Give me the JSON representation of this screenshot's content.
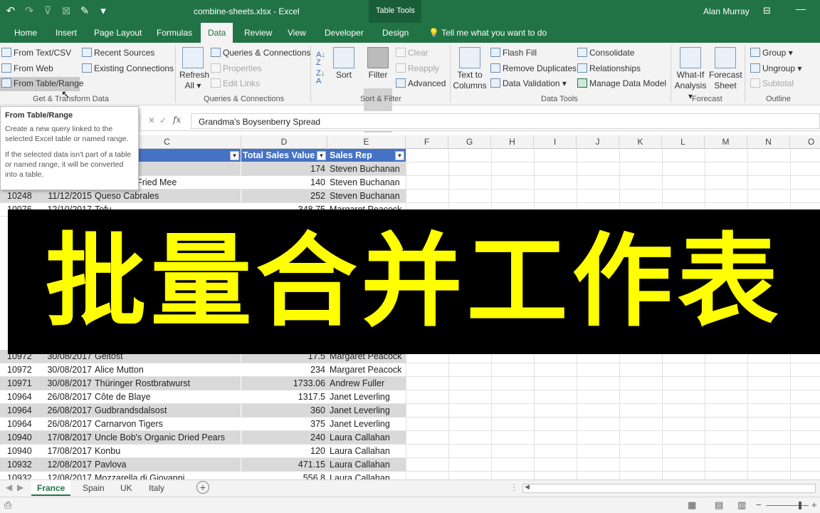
{
  "window": {
    "title": "combine-sheets.xlsx  -  Excel",
    "context_tab": "Table Tools",
    "user": "Alan Murray"
  },
  "tabs": [
    "Home",
    "Insert",
    "Page Layout",
    "Formulas",
    "Data",
    "Review",
    "View",
    "Developer",
    "Design"
  ],
  "tell_me": "Tell me what you want to do",
  "ribbon": {
    "get_transform": {
      "label": "Get & Transform Data",
      "from_text": "From Text/CSV",
      "from_web": "From Web",
      "from_table": "From Table/Range",
      "recent": "Recent Sources",
      "existing": "Existing Connections"
    },
    "queries": {
      "label": "Queries & Connections",
      "refresh": "Refresh",
      "refresh_all": "All",
      "qc": "Queries & Connections",
      "properties": "Properties",
      "edit_links": "Edit Links"
    },
    "sort_filter": {
      "label": "Sort & Filter",
      "sort": "Sort",
      "filter": "Filter",
      "clear": "Clear",
      "reapply": "Reapply",
      "advanced": "Advanced"
    },
    "data_tools": {
      "label": "Data Tools",
      "ttc1": "Text to",
      "ttc2": "Columns",
      "flash": "Flash Fill",
      "remove_dup": "Remove Duplicates",
      "validation": "Data Validation",
      "consolidate": "Consolidate",
      "relationships": "Relationships",
      "model": "Manage Data Model"
    },
    "forecast": {
      "label": "Forecast",
      "whatif1": "What-If",
      "whatif2": "Analysis",
      "fs1": "Forecast",
      "fs2": "Sheet"
    },
    "outline": {
      "label": "Outline",
      "group": "Group",
      "ungroup": "Ungroup",
      "subtotal": "Subtotal"
    }
  },
  "formula": {
    "value": "Grandma's Boysenberry Spread"
  },
  "columns": [
    "C",
    "D",
    "E",
    "F",
    "G",
    "H",
    "I",
    "J",
    "K",
    "L",
    "M",
    "N",
    "O"
  ],
  "tooltip": {
    "title": "From Table/Range",
    "p1": "Create a new query linked to the selected Excel table or named range.",
    "p2": "If the selected data isn't part of a table or named range, it will be converted into a table."
  },
  "table": {
    "headers": {
      "product": "me",
      "sales": "Total Sales Value",
      "rep": "Sales Rep"
    },
    "top_rows": [
      {
        "id": "",
        "date": "",
        "product": "di Giovanni",
        "value": "174",
        "rep": "Steven Buchanan"
      },
      {
        "id": "",
        "date": "",
        "product": "n Hokkien Fried Mee",
        "value": "140",
        "rep": "Steven Buchanan"
      },
      {
        "id": "10248",
        "date": "11/12/2015",
        "product": "Queso Cabrales",
        "value": "252",
        "rep": "Steven Buchanan"
      },
      {
        "id": "10076",
        "date": "12/10/2017",
        "product": "Tofu",
        "value": "348.75",
        "rep": "Margaret Peacock"
      }
    ],
    "bottom_rows": [
      {
        "id": "10972",
        "date": "30/08/2017",
        "product": "Geitost",
        "value": "17.5",
        "rep": "Margaret Peacock"
      },
      {
        "id": "10972",
        "date": "30/08/2017",
        "product": "Alice Mutton",
        "value": "234",
        "rep": "Margaret Peacock"
      },
      {
        "id": "10971",
        "date": "30/08/2017",
        "product": "Thüringer Rostbratwurst",
        "value": "1733.06",
        "rep": "Andrew Fuller"
      },
      {
        "id": "10964",
        "date": "26/08/2017",
        "product": "Côte de Blaye",
        "value": "1317.5",
        "rep": "Janet Leverling"
      },
      {
        "id": "10964",
        "date": "26/08/2017",
        "product": "Gudbrandsdalsost",
        "value": "360",
        "rep": "Janet Leverling"
      },
      {
        "id": "10964",
        "date": "26/08/2017",
        "product": "Carnarvon Tigers",
        "value": "375",
        "rep": "Janet Leverling"
      },
      {
        "id": "10940",
        "date": "17/08/2017",
        "product": "Uncle Bob's Organic Dried Pears",
        "value": "240",
        "rep": "Laura Callahan"
      },
      {
        "id": "10940",
        "date": "17/08/2017",
        "product": "Konbu",
        "value": "120",
        "rep": "Laura Callahan"
      },
      {
        "id": "10932",
        "date": "12/08/2017",
        "product": "Pavlova",
        "value": "471.15",
        "rep": "Laura Callahan"
      },
      {
        "id": "10932",
        "date": "12/08/2017",
        "product": "Mozzarella di Giovanni",
        "value": "556.8",
        "rep": "Laura Callahan"
      }
    ]
  },
  "banner": {
    "text": "批量合并工作表"
  },
  "sheets": [
    "France",
    "Spain",
    "UK",
    "Italy"
  ]
}
